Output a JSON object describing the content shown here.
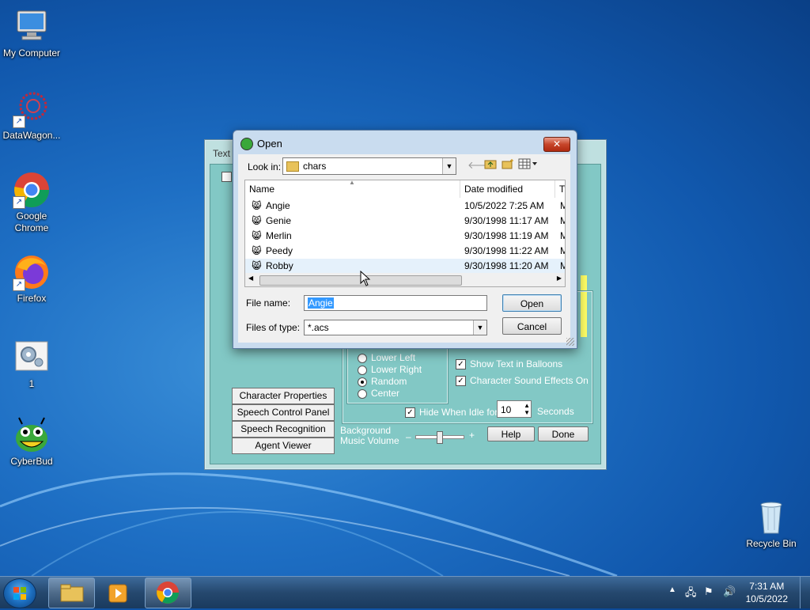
{
  "desktop": {
    "icons": [
      {
        "label": "My Computer"
      },
      {
        "label": "DataWagon..."
      },
      {
        "label": "Google Chrome"
      },
      {
        "label": "Firefox"
      },
      {
        "label": "1"
      },
      {
        "label": "CyberBud"
      },
      {
        "label": "Recycle Bin"
      }
    ]
  },
  "agent_window": {
    "tab_label": "Text",
    "buttons": [
      "Character Properties",
      "Speech Control Panel",
      "Speech Recognition",
      "Agent Viewer"
    ],
    "positions": [
      "Lower Left",
      "Lower Right",
      "Random",
      "Center"
    ],
    "selected_position": "Random",
    "checks": [
      "Show Text in Balloons",
      "Character Sound Effects On"
    ],
    "hide_idle_label": "Hide When Idle for",
    "hide_idle_value": "10",
    "seconds_label": "Seconds",
    "bg_music_label_1": "Background",
    "bg_music_label_2": "Music Volume",
    "minus": "–",
    "plus": "+",
    "help": "Help",
    "done": "Done"
  },
  "open_dialog": {
    "title": "Open",
    "close": "✕",
    "look_in_label": "Look in:",
    "look_in_value": "chars",
    "columns": {
      "name": "Name",
      "date": "Date modified",
      "type": "Ty"
    },
    "files": [
      {
        "name": "Angie",
        "date": "10/5/2022 7:25 AM",
        "type": "M"
      },
      {
        "name": "Genie",
        "date": "9/30/1998 11:17 AM",
        "type": "M"
      },
      {
        "name": "Merlin",
        "date": "9/30/1998 11:19 AM",
        "type": "M"
      },
      {
        "name": "Peedy",
        "date": "9/30/1998 11:22 AM",
        "type": "M"
      },
      {
        "name": "Robby",
        "date": "9/30/1998 11:20 AM",
        "type": "M"
      }
    ],
    "file_name_label": "File name:",
    "file_name_value": "Angie",
    "files_of_type_label": "Files of type:",
    "files_of_type_value": "*.acs",
    "open_btn": "Open",
    "cancel_btn": "Cancel"
  },
  "taskbar": {
    "time": "7:31 AM",
    "date": "10/5/2022"
  }
}
